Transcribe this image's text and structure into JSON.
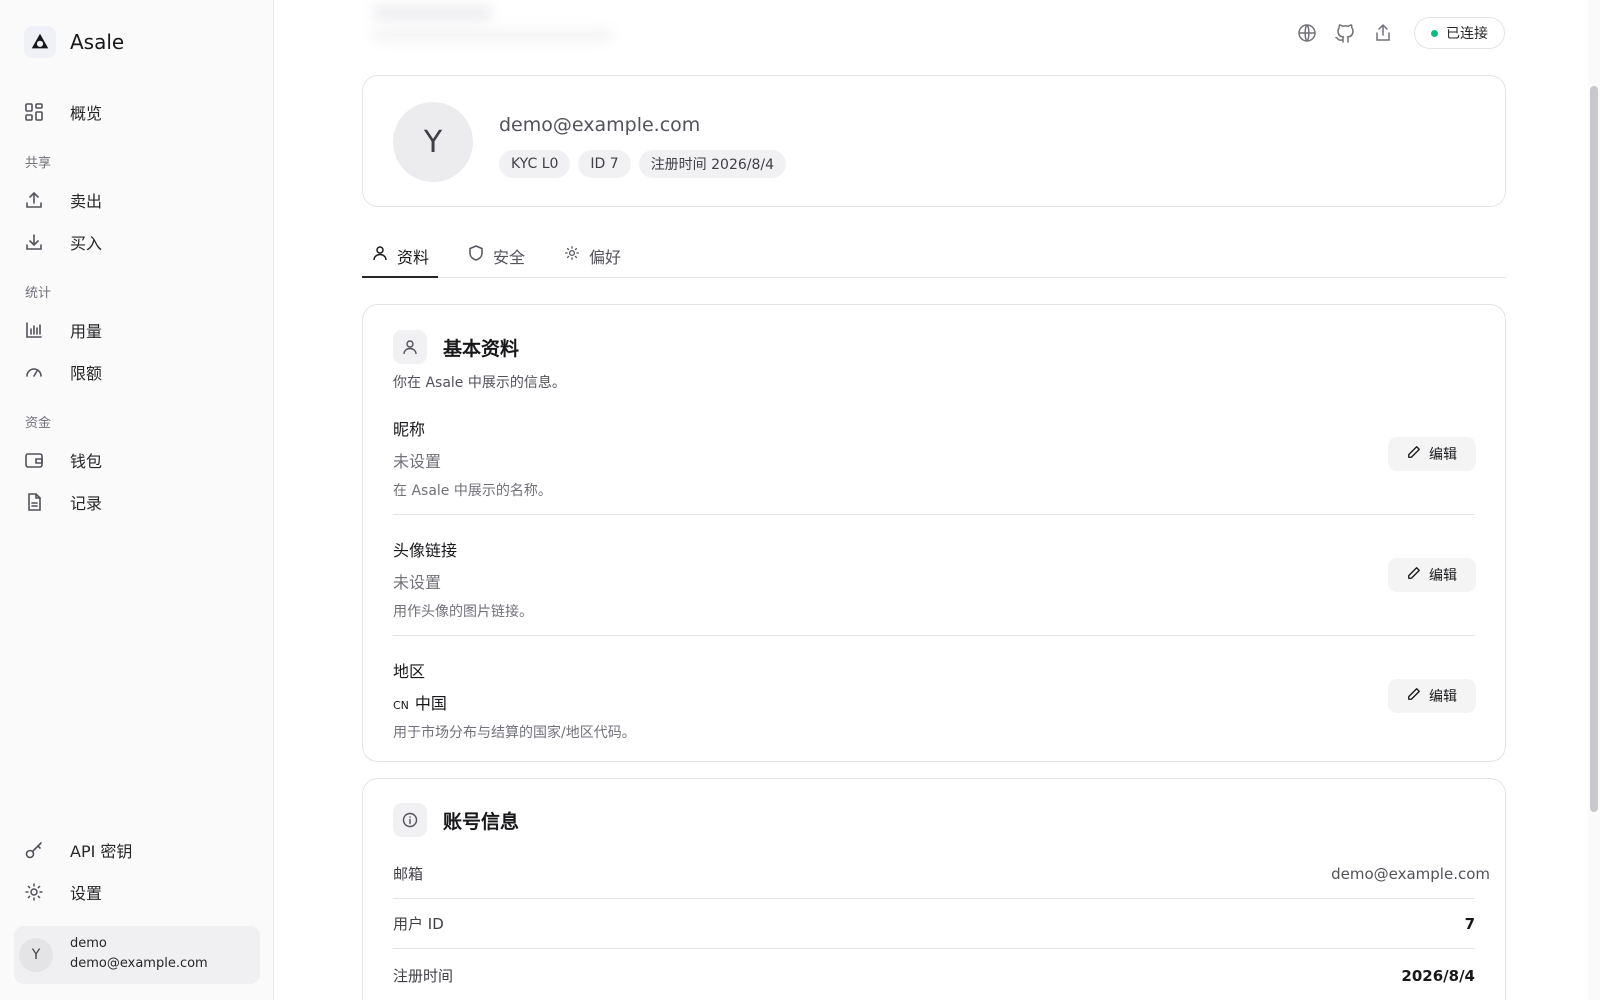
{
  "brand": {
    "name": "Asale",
    "logo_icon": "triangle-logo-icon"
  },
  "sidebar": {
    "overview": "概览",
    "sections": {
      "share": "共享",
      "stats": "统计",
      "funds": "资金"
    },
    "items": {
      "sell": "卖出",
      "buy": "买入",
      "usage": "用量",
      "limits": "限额",
      "wallet": "钱包",
      "records": "记录",
      "api_keys": "API 密钥",
      "settings": "设置"
    },
    "user": {
      "avatar": "Y",
      "name": "demo",
      "email": "demo@example.com"
    }
  },
  "topbar": {
    "icons": [
      "globe-icon",
      "github-icon",
      "share-icon"
    ],
    "status": "已连接",
    "status_color": "#10b981"
  },
  "profile": {
    "avatar": "Y",
    "email": "demo@example.com",
    "badges": [
      "KYC L0",
      "ID 7",
      "注册时间 2026/8/4"
    ]
  },
  "tabs": {
    "profile": "资料",
    "security": "安全",
    "preferences": "偏好"
  },
  "basic": {
    "title": "基本资料",
    "desc": "你在 Asale 中展示的信息。",
    "edit_label": "编辑",
    "fields": [
      {
        "label": "昵称",
        "value": "未设置",
        "help": "在 Asale 中展示的名称。"
      },
      {
        "label": "头像链接",
        "value": "未设置",
        "help": "用作头像的图片链接。"
      },
      {
        "label": "地区",
        "code": "CN",
        "value": "中国",
        "help": "用于市场分布与结算的国家/地区代码。"
      }
    ]
  },
  "account": {
    "title": "账号信息",
    "rows": [
      {
        "label": "邮箱",
        "value": "demo@example.com"
      },
      {
        "label": "用户 ID",
        "value": "7"
      },
      {
        "label": "注册时间",
        "value": "2026/8/4"
      }
    ]
  }
}
